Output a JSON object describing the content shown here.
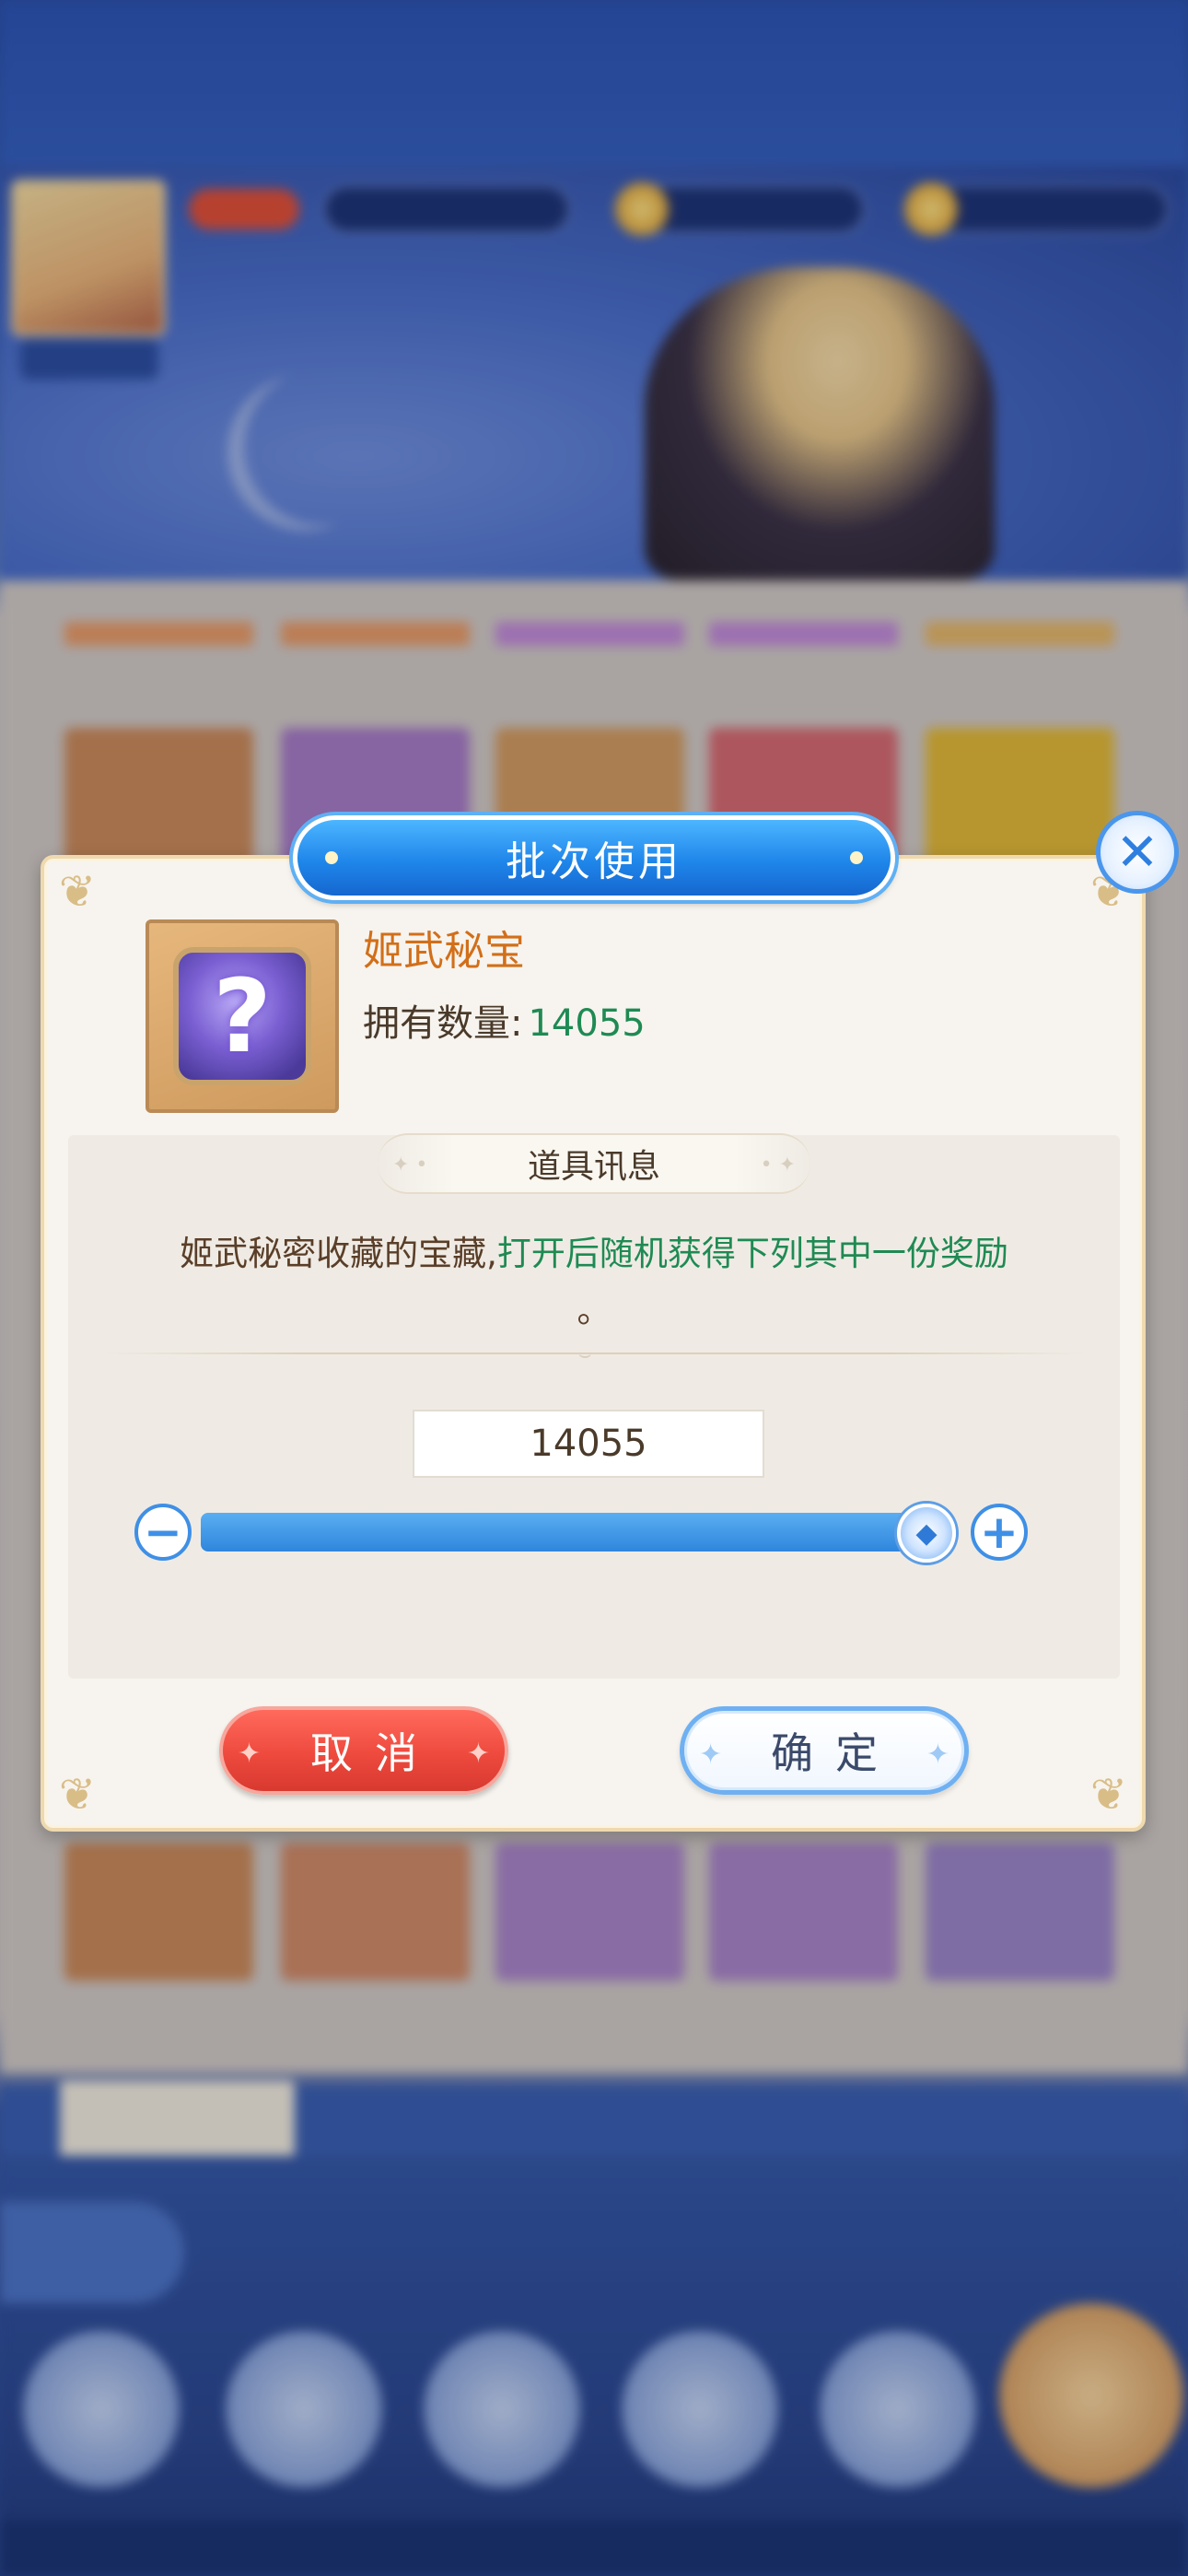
{
  "dialog": {
    "title": "批次使用",
    "close_icon": "close-icon"
  },
  "item": {
    "name": "姬武秘宝",
    "count_label": "拥有数量:",
    "count_value": "14055",
    "icon": "mystery-chest-icon"
  },
  "info": {
    "section_title": "道具讯息",
    "description_part1": "姬武秘密收藏的宝藏,",
    "description_part2": "打开后随机获得下列其中一份奖励",
    "description_end": "。"
  },
  "quantity": {
    "value": "14055",
    "slider_fraction": 1.0,
    "minus_icon": "minus-icon",
    "plus_icon": "plus-icon"
  },
  "buttons": {
    "cancel_label": "取消",
    "confirm_label": "确定"
  },
  "colors": {
    "accent_blue": "#1f86ea",
    "name_orange": "#d26f19",
    "count_green": "#1f8a53",
    "cancel_red": "#ee4a3e"
  }
}
